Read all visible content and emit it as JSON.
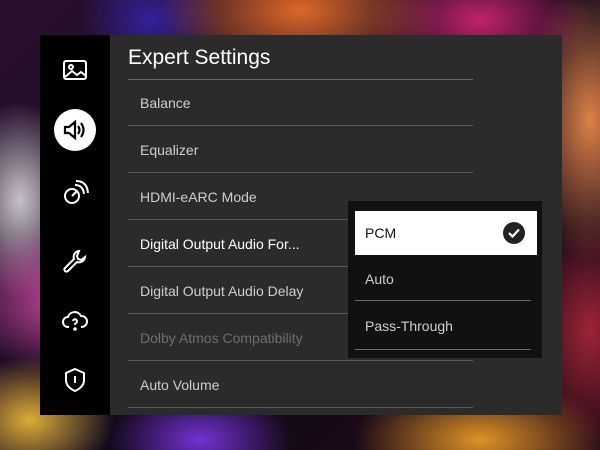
{
  "panel": {
    "title": "Expert Settings",
    "items": [
      {
        "label": "Balance",
        "state": "normal"
      },
      {
        "label": "Equalizer",
        "state": "normal"
      },
      {
        "label": "HDMI-eARC Mode",
        "state": "normal"
      },
      {
        "label": "Digital Output Audio For...",
        "state": "focused"
      },
      {
        "label": "Digital Output Audio Delay",
        "state": "normal"
      },
      {
        "label": "Dolby Atmos Compatibility",
        "state": "disabled"
      },
      {
        "label": "Auto Volume",
        "state": "normal"
      }
    ]
  },
  "sidebar": {
    "items": [
      {
        "icon": "picture-icon",
        "active": false
      },
      {
        "icon": "sound-icon",
        "active": true
      },
      {
        "icon": "connection-icon",
        "active": false
      },
      {
        "icon": "wrench-icon",
        "active": false
      },
      {
        "icon": "cloud-help-icon",
        "active": false
      },
      {
        "icon": "shield-icon",
        "active": false
      }
    ]
  },
  "dropdown": {
    "options": [
      {
        "label": "PCM",
        "selected": true
      },
      {
        "label": "Auto",
        "selected": false
      },
      {
        "label": "Pass-Through",
        "selected": false
      }
    ]
  }
}
